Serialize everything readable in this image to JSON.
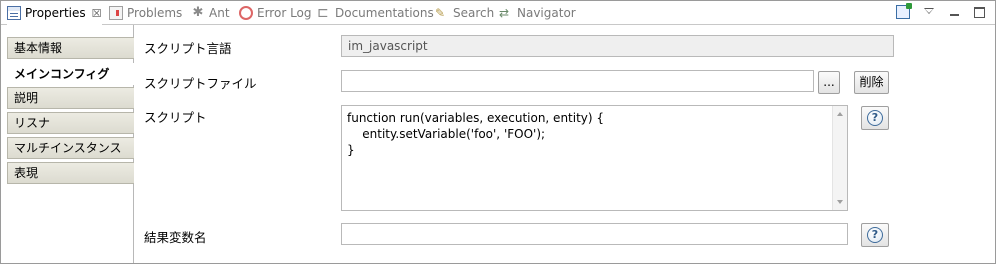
{
  "tabs": [
    {
      "label": "Properties",
      "icon": "properties-icon",
      "active": true
    },
    {
      "label": "Problems",
      "icon": "problems-icon"
    },
    {
      "label": "Ant",
      "icon": "ant-icon"
    },
    {
      "label": "Error Log",
      "icon": "error-log-icon"
    },
    {
      "label": "Documentations",
      "icon": "documentations-icon"
    },
    {
      "label": "Search",
      "icon": "search-icon"
    },
    {
      "label": "Navigator",
      "icon": "navigator-icon"
    }
  ],
  "tab_close_glyph": "☒",
  "window_buttons": [
    "pin-icon",
    "view-menu-icon",
    "minimize-icon",
    "maximize-icon"
  ],
  "sidebar": {
    "items": [
      {
        "label": "基本情報"
      },
      {
        "label": "メインコンフィグ",
        "active": true
      },
      {
        "label": "説明"
      },
      {
        "label": "リスナ"
      },
      {
        "label": "マルチインスタンス"
      },
      {
        "label": "表現"
      }
    ]
  },
  "form": {
    "script_language": {
      "label": "スクリプト言語",
      "value": "im_javascript"
    },
    "script_file": {
      "label": "スクリプトファイル",
      "value": "",
      "browse_label": "...",
      "delete_label": "削除"
    },
    "script": {
      "label": "スクリプト",
      "lines": [
        "function run(variables, execution, entity) {",
        "    entity.setVariable('foo', 'FOO');",
        "}"
      ]
    },
    "result_variable": {
      "label": "結果変数名",
      "value": ""
    },
    "help_glyph": "?"
  },
  "colors": {
    "accent": "#3f6c9b",
    "nav_bg": "#dcdbd0",
    "border": "#b9b9b9"
  }
}
